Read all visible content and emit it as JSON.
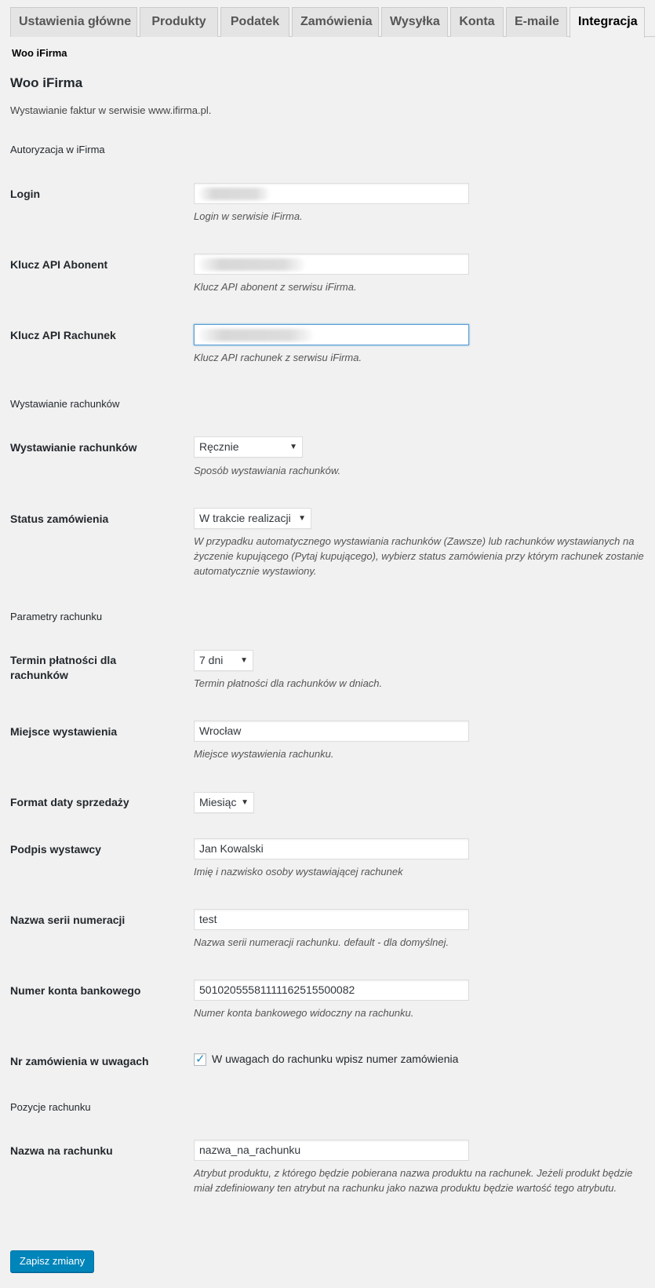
{
  "tabs": [
    "Ustawienia główne",
    "Produkty",
    "Podatek",
    "Zamówienia",
    "Wysyłka",
    "Konta",
    "E-maile",
    "Integracja"
  ],
  "sublink": "Woo iFirma",
  "title": "Woo iFirma",
  "intro": "Wystawianie faktur w serwisie www.ifirma.pl.",
  "sections": {
    "auth": "Autoryzacja w iFirma",
    "invoicing": "Wystawianie rachunków",
    "params": "Parametry rachunku",
    "items": "Pozycje rachunku"
  },
  "fields": {
    "login": {
      "label": "Login",
      "value": "",
      "desc": "Login w serwisie iFirma."
    },
    "api_abonent": {
      "label": "Klucz API Abonent",
      "value": "",
      "desc": "Klucz API abonent z serwisu iFirma."
    },
    "api_rachunek": {
      "label": "Klucz API Rachunek",
      "value": "",
      "desc": "Klucz API rachunek z serwisu iFirma."
    },
    "invoicing_mode": {
      "label": "Wystawianie rachunków",
      "value": "Ręcznie",
      "desc": "Sposób wystawiania rachunków."
    },
    "order_status": {
      "label": "Status zamówienia",
      "value": "W trakcie realizacji",
      "desc": "W przypadku automatycznego wystawiania rachunków (Zawsze) lub rachunków wystawianych na życzenie kupującego (Pytaj kupującego), wybierz status zamówienia przy którym rachunek zostanie automatycznie wystawiony."
    },
    "payment_term": {
      "label": "Termin płatności dla rachunków",
      "value": "7 dni",
      "desc": "Termin płatności dla rachunków w dniach."
    },
    "issue_place": {
      "label": "Miejsce wystawienia",
      "value": "Wrocław",
      "desc": "Miejsce wystawienia rachunku."
    },
    "sale_date_format": {
      "label": "Format daty sprzedaży",
      "value": "Miesiąc"
    },
    "issuer_signature": {
      "label": "Podpis wystawcy",
      "value": "Jan Kowalski",
      "desc": "Imię i nazwisko osoby wystawiającej rachunek"
    },
    "series_name": {
      "label": "Nazwa serii numeracji",
      "value": "test",
      "desc": "Nazwa serii numeracji rachunku. default - dla domyślnej."
    },
    "bank_account": {
      "label": "Numer konta bankowego",
      "value": "50102055581111162515500082",
      "desc": "Numer konta bankowego widoczny na rachunku."
    },
    "order_in_notes": {
      "label": "Nr zamówienia w uwagach",
      "checked": true,
      "check_label": "W uwagach do rachunku wpisz numer zamówienia"
    },
    "invoice_name": {
      "label": "Nazwa na rachunku",
      "value": "nazwa_na_rachunku",
      "desc": "Atrybut produktu, z którego będzie pobierana nazwa produktu na rachunek. Jeżeli produkt będzie miał zdefiniowany ten atrybut na rachunku jako nazwa produktu będzie wartość tego atrybutu."
    }
  },
  "save_button": "Zapisz zmiany",
  "colors": {
    "accent": "#0085ba",
    "focus": "#5b9dd9",
    "check": "#1e8cbe"
  }
}
